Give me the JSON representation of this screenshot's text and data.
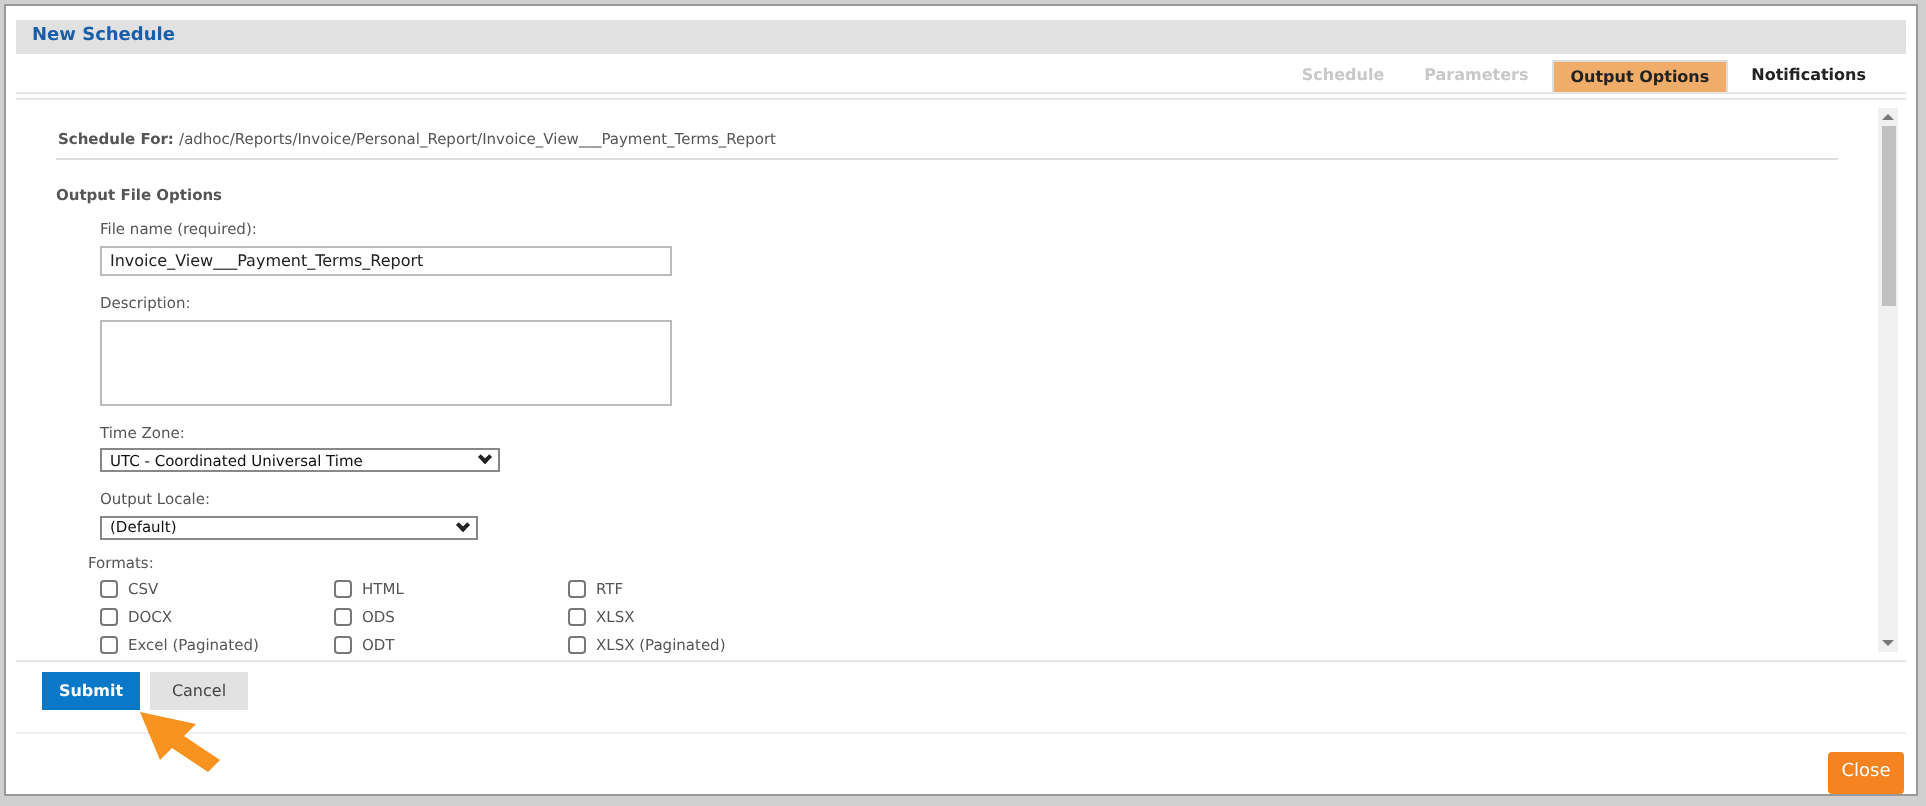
{
  "dialog": {
    "title": "New Schedule"
  },
  "tabs": [
    {
      "label": "Schedule",
      "selected": false,
      "disabled": true
    },
    {
      "label": "Parameters",
      "selected": false,
      "disabled": true
    },
    {
      "label": "Output Options",
      "selected": true,
      "disabled": false
    },
    {
      "label": "Notifications",
      "selected": false,
      "disabled": false
    }
  ],
  "schedule_for": {
    "label": "Schedule For:",
    "path": "/adhoc/Reports/Invoice/Personal_Report/Invoice_View___Payment_Terms_Report"
  },
  "section_title": "Output File Options",
  "file_name": {
    "label": "File name (required):",
    "value": "Invoice_View___Payment_Terms_Report"
  },
  "description": {
    "label": "Description:"
  },
  "time_zone": {
    "label": "Time Zone:",
    "value": "UTC - Coordinated Universal Time"
  },
  "output_locale": {
    "label": "Output Locale:",
    "value": "(Default)"
  },
  "formats": {
    "label": "Formats:",
    "options": [
      {
        "label": "CSV",
        "checked": false
      },
      {
        "label": "HTML",
        "checked": false
      },
      {
        "label": "RTF",
        "checked": false
      },
      {
        "label": "DOCX",
        "checked": false
      },
      {
        "label": "ODS",
        "checked": false
      },
      {
        "label": "XLSX",
        "checked": false
      },
      {
        "label": "Excel (Paginated)",
        "checked": false
      },
      {
        "label": "ODT",
        "checked": false
      },
      {
        "label": "XLSX (Paginated)",
        "checked": false
      }
    ]
  },
  "buttons": [
    {
      "label": "Submit",
      "kind": "primary"
    },
    {
      "label": "Cancel",
      "kind": "secondary"
    }
  ],
  "footer": {
    "close": "Close"
  }
}
